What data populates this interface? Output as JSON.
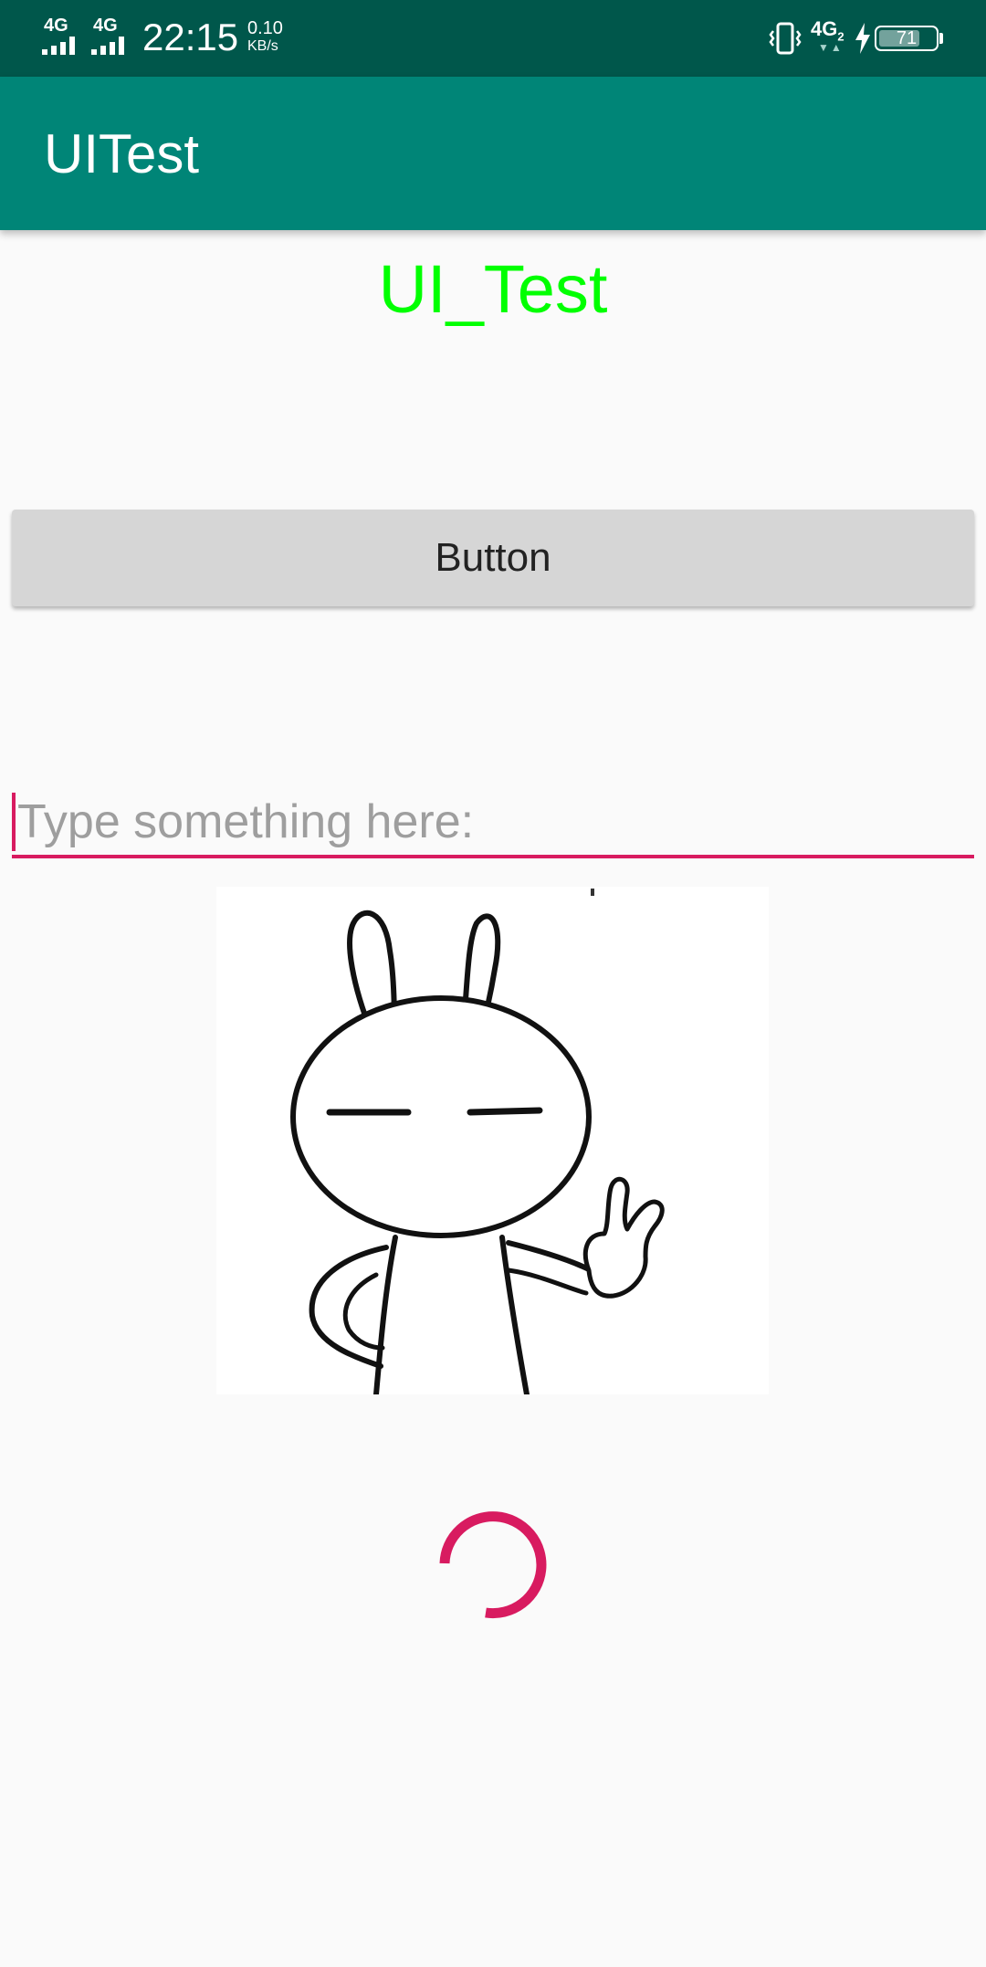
{
  "status_bar": {
    "network_1": "4G",
    "network_2": "4G",
    "time": "22:15",
    "net_speed_value": "0.10",
    "net_speed_unit": "KB/s",
    "lte_label": "4G",
    "lte_sim": "2",
    "battery_level": "71",
    "icons": [
      "signal-icon",
      "signal-icon",
      "vibrate-icon",
      "charging-icon",
      "battery-icon"
    ]
  },
  "app_bar": {
    "title": "UITest",
    "color": "#008577"
  },
  "main": {
    "heading": "UI_Test",
    "heading_color": "#00ff00",
    "button_label": "Button",
    "input": {
      "value": "",
      "placeholder": "Type something here:"
    },
    "image": "rabbit-peace-sign-image",
    "progress": "indeterminate",
    "accent_color": "#d81b60"
  }
}
